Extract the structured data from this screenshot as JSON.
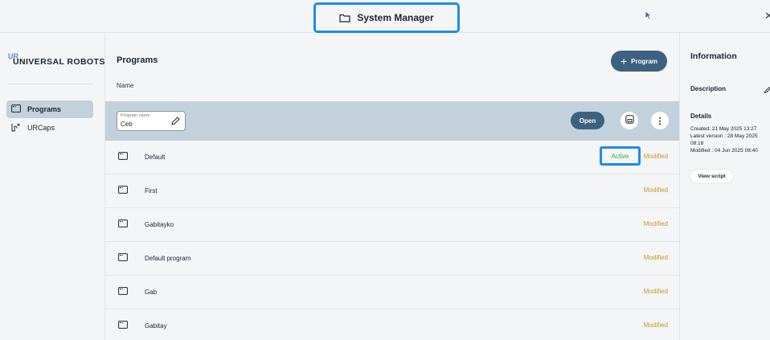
{
  "header": {
    "title": "System Manager"
  },
  "sidebar": {
    "logo_mark": "UR",
    "brand": "UNIVERSAL ROBOTS",
    "items": [
      {
        "label": "Programs",
        "icon": "program-icon",
        "active": true
      },
      {
        "label": "URCaps",
        "icon": "urcaps-icon",
        "active": false
      }
    ]
  },
  "main": {
    "title": "Programs",
    "add_button_label": "Program",
    "column_header": "Name",
    "selected": {
      "field_placeholder": "Program name",
      "field_value": "Ceb",
      "open_label": "Open"
    },
    "rows": [
      {
        "name": "Default",
        "status": "Modified",
        "badge": "Active"
      },
      {
        "name": "First",
        "status": "Modified"
      },
      {
        "name": "Gabitayko",
        "status": "Modified"
      },
      {
        "name": "Default program",
        "status": "Modified"
      },
      {
        "name": "Gab",
        "status": "Modified"
      },
      {
        "name": "Gabitay",
        "status": "Modified"
      }
    ]
  },
  "info": {
    "title": "Information",
    "description_label": "Description",
    "details_label": "Details",
    "details": [
      "Created: 21 May 2025 13:27",
      "Latest version : 28 May 2025",
      "08:18",
      "Modified : 04 Jun 2025 08:40"
    ],
    "view_script_label": "View script"
  },
  "colors": {
    "accent_button": "#3d6180",
    "highlight_box": "#1e8ce6",
    "modified": "#c69a2a",
    "active": "#3aa657",
    "selected_row": "#c3d1dc"
  }
}
